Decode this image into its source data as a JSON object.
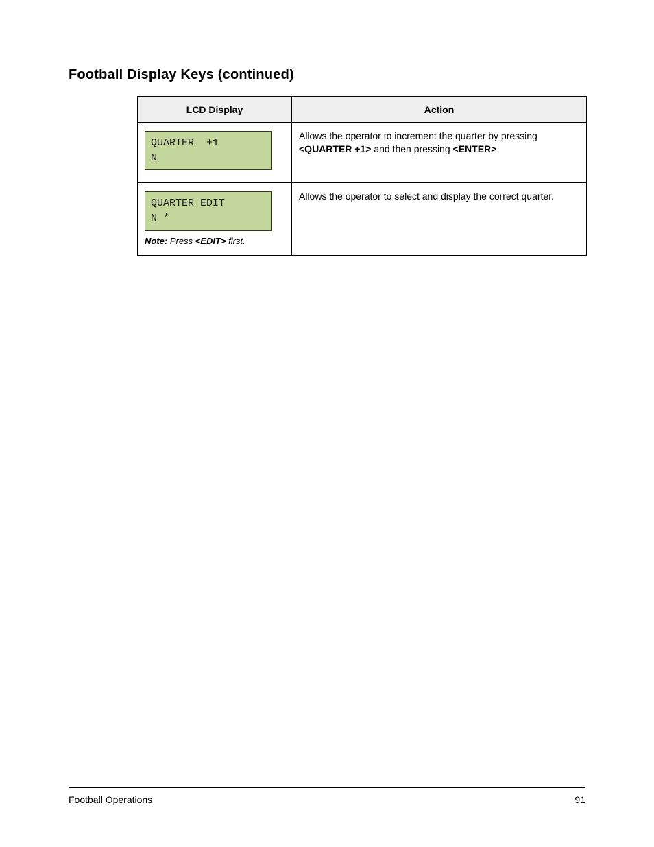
{
  "heading": "Football Display Keys (continued)",
  "table": {
    "headers": {
      "col1": "LCD Display",
      "col2": "Action"
    },
    "rows": [
      {
        "lcd": "QUARTER  +1\nN",
        "desc_html": "Allows the operator to increment the quarter by pressing <span class=\"inline-bold\">&lt;QUARTER +1&gt;</span> and then pressing <span class=\"inline-bold\">&lt;ENTER&gt;</span>.",
        "note": null
      },
      {
        "lcd": "QUARTER EDIT\nN *",
        "desc_html": "",
        "desc_extra_html": "Allows the operator to select and display the correct quarter.",
        "note_html": "<span class=\"inline-bold\">Note:</span> Press <span class=\"inline-bold\">&lt;EDIT&gt;</span> first."
      }
    ]
  },
  "footer": {
    "left": "Football Operations",
    "right": "91"
  }
}
